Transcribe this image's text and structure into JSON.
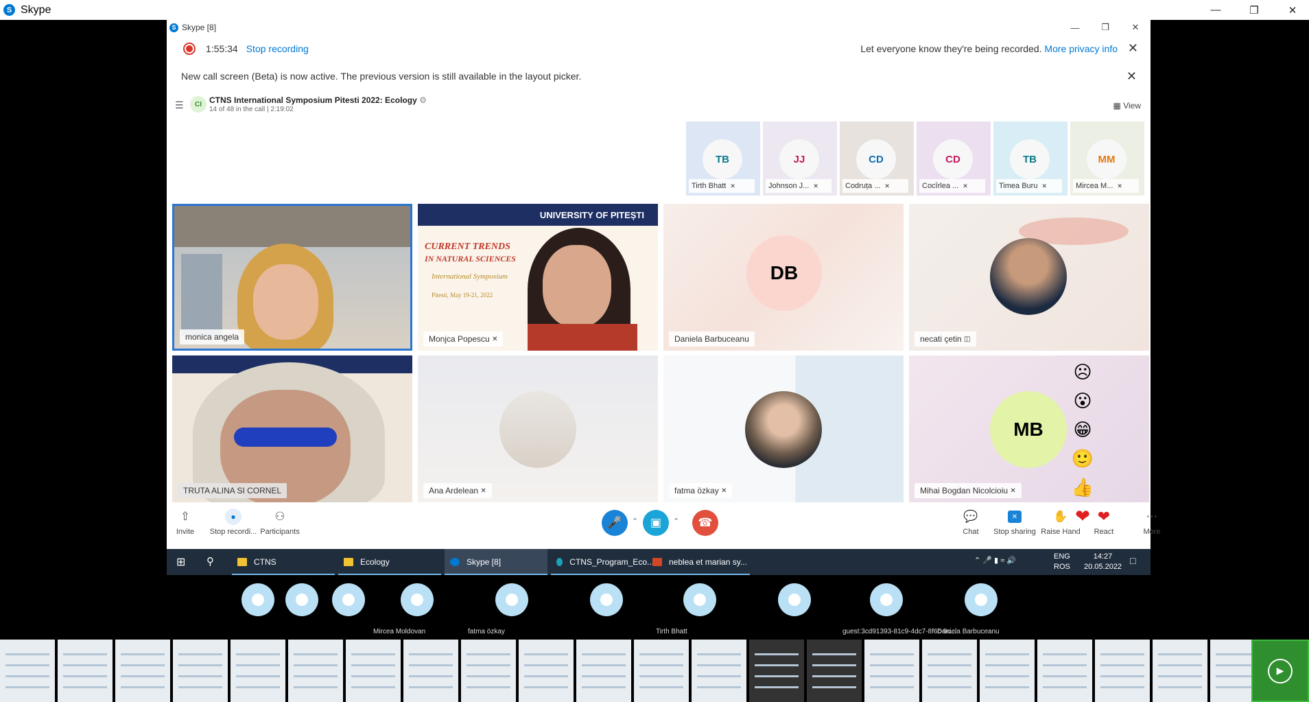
{
  "outer_window": {
    "app_title": "Skype",
    "logo": "S"
  },
  "inner_window": {
    "title": "Skype [8]",
    "logo": "S"
  },
  "recording": {
    "elapsed": "1:55:34",
    "stop_label": "Stop recording",
    "notice": "Let everyone know they're being recorded.",
    "privacy_link": "More privacy info"
  },
  "banner": {
    "text": "New call screen (Beta) is now active. The previous version is still available in the layout picker."
  },
  "call": {
    "avatar_initials": "CI",
    "title": "CTNS International Symposium Pitesti 2022: Ecology",
    "subtitle": "14 of 48 in the call | 2:19:02",
    "view_label": "View"
  },
  "strip": [
    {
      "initials": "TB",
      "name": "Tirth Bhatt",
      "color": "#0a7a8a",
      "bg": "#dde6f4"
    },
    {
      "initials": "JJ",
      "name": "Johnson J...",
      "color": "#c2185b",
      "bg": "#ece7f0"
    },
    {
      "initials": "CD",
      "name": "Codruța ...",
      "color": "#0d6db5",
      "bg": "#e7e2dd"
    },
    {
      "initials": "CD",
      "name": "Cocîrlea ...",
      "color": "#c2185b",
      "bg": "#ebdff0"
    },
    {
      "initials": "TB",
      "name": "Timea Buru",
      "color": "#0a7a8a",
      "bg": "#d8edf5"
    },
    {
      "initials": "MM",
      "name": "Mircea M...",
      "color": "#e07a10",
      "bg": "#ecefe4"
    }
  ],
  "tiles": [
    {
      "name": "monica angela",
      "kind": "video"
    },
    {
      "name": "Monjca Popescu",
      "kind": "video",
      "overlay_title": "UNIVERSITY OF PITEȘTI",
      "overlay_line1": "CURRENT TRENDS",
      "overlay_line2": "IN NATURAL SCIENCES",
      "overlay_line3": "International Symposium",
      "overlay_date": "Pitesti, May 19-21, 2022"
    },
    {
      "name": "Daniela Barbuceanu",
      "kind": "initials",
      "initials": "DB",
      "color": "#c62828"
    },
    {
      "name": "necati çetin",
      "kind": "photo"
    },
    {
      "name": "TRUTA ALINA SI CORNEL",
      "kind": "video"
    },
    {
      "name": "Ana Ardelean",
      "kind": "photo"
    },
    {
      "name": "fatma özkay",
      "kind": "photo"
    },
    {
      "name": "Mihai Bogdan Nicolcioiu",
      "kind": "initials",
      "initials": "MB",
      "color": "#6a8a10"
    }
  ],
  "toolbar": {
    "invite": "Invite",
    "stop_recording": "Stop recordi...",
    "participants": "Participants",
    "chat": "Chat",
    "stop_sharing": "Stop sharing",
    "raise_hand": "Raise Hand",
    "react": "React",
    "more": "More"
  },
  "reactions": [
    "☹",
    "😮",
    "😁",
    "🙂",
    "👍",
    "❤"
  ],
  "taskbar": {
    "items": [
      "CTNS",
      "Ecology",
      "Skype [8]",
      "CTNS_Program_Eco...",
      "neblea et marian sy..."
    ],
    "lang1": "ENG",
    "lang2": "ROS",
    "time": "14:27",
    "date": "20.05.2022"
  },
  "bottom_people": [
    {
      "name": ""
    },
    {
      "name": ""
    },
    {
      "name": ""
    },
    {
      "name": "Mircea Moldovan"
    },
    {
      "name": "fatma özkay"
    },
    {
      "name": ""
    },
    {
      "name": "Tirth Bhatt"
    },
    {
      "name": ""
    },
    {
      "name": "guest:3cd91393-81c9-4dc7-8f6c-9c..."
    },
    {
      "name": "Daniela Barbuceanu"
    }
  ]
}
